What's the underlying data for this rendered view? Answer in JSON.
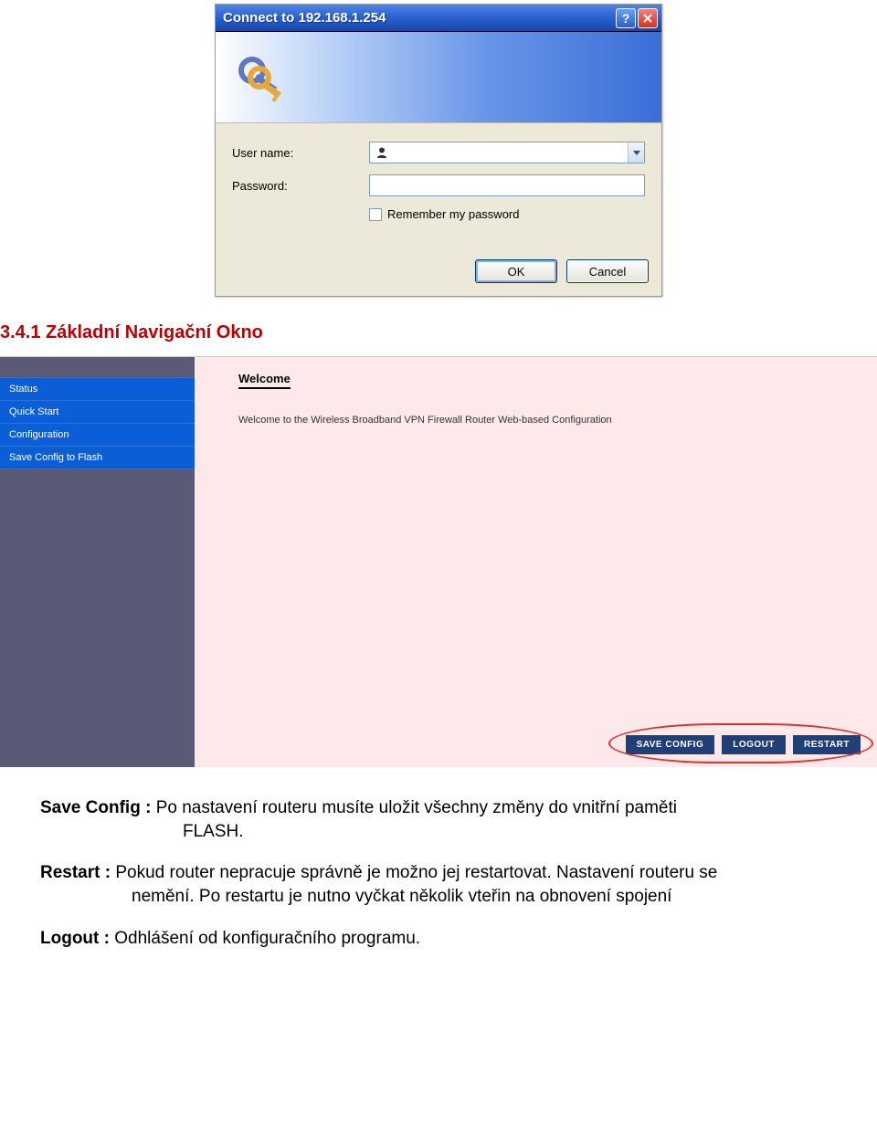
{
  "dialog": {
    "title": "Connect to 192.168.1.254",
    "username_label": "User name:",
    "password_label": "Password:",
    "remember_label": "Remember my password",
    "ok": "OK",
    "cancel": "Cancel"
  },
  "section_heading": "3.4.1 Základní Navigační Okno",
  "nav": {
    "items": [
      "Status",
      "Quick Start",
      "Configuration",
      "Save Config to Flash"
    ]
  },
  "panel": {
    "title": "Welcome",
    "subtitle": "Welcome to the Wireless Broadband VPN Firewall Router Web-based Configuration"
  },
  "buttons": {
    "save": "SAVE CONFIG",
    "logout": "LOGOUT",
    "restart": "RESTART"
  },
  "paras": {
    "save_label": "Save Config :",
    "save_text1": "Po nastavení routeru musíte uložit  všechny změny do vnitřní paměti",
    "save_text2": "FLASH.",
    "restart_label": "Restart :",
    "restart_text1": "Pokud router nepracuje správně je možno jej restartovat. Nastavení routeru se",
    "restart_text2": "nemění. Po restartu je nutno vyčkat několik vteřin na obnovení spojení",
    "logout_label": "Logout :",
    "logout_text": "Odhlášení od konfiguračního programu."
  }
}
